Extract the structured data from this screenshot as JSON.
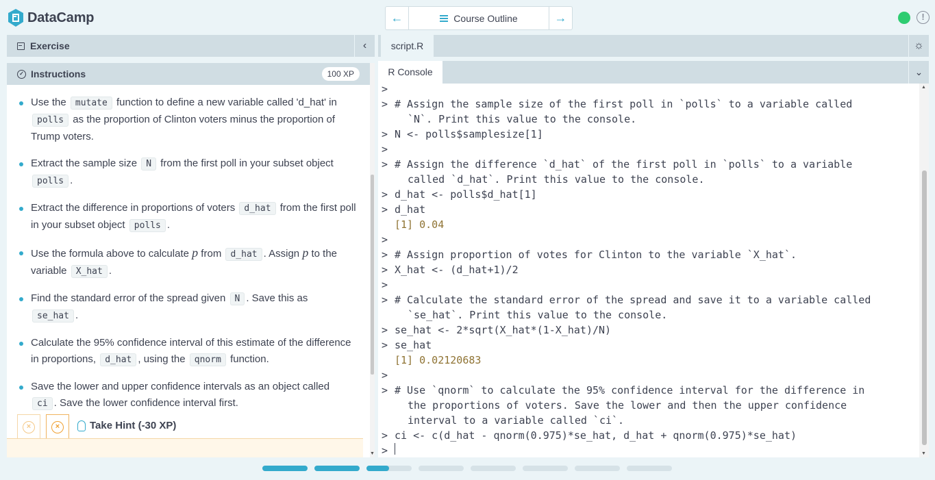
{
  "brand": {
    "name": "DataCamp",
    "color": "#33aacc"
  },
  "nav": {
    "outline_label": "Course Outline",
    "prev_icon": "arrow-left-icon",
    "next_icon": "arrow-right-icon",
    "status_color": "#2ecc71",
    "alert_symbol": "!"
  },
  "left": {
    "exercise_label": "Exercise",
    "collapse_symbol": "‹",
    "instructions_label": "Instructions",
    "xp": "100 XP",
    "items": [
      {
        "parts": [
          {
            "t": "Use the "
          },
          {
            "c": "mutate"
          },
          {
            "t": " function to define a new variable called 'd_hat' in "
          },
          {
            "c": "polls"
          },
          {
            "t": " as the proportion of Clinton voters minus the proportion of Trump voters."
          }
        ]
      },
      {
        "parts": [
          {
            "t": "Extract the sample size "
          },
          {
            "c": "N"
          },
          {
            "t": " from the first poll in your subset object "
          },
          {
            "c": "polls"
          },
          {
            "t": "."
          }
        ]
      },
      {
        "parts": [
          {
            "t": "Extract the difference in proportions of voters "
          },
          {
            "c": "d_hat"
          },
          {
            "t": " from the first poll in your subset object "
          },
          {
            "c": "polls"
          },
          {
            "t": "."
          }
        ]
      },
      {
        "parts": [
          {
            "t": "Use the formula above to calculate "
          },
          {
            "m": "p"
          },
          {
            "t": " from "
          },
          {
            "c": "d_hat"
          },
          {
            "t": ". Assign "
          },
          {
            "m": "p"
          },
          {
            "t": " to the variable "
          },
          {
            "c": "X_hat"
          },
          {
            "t": "."
          }
        ]
      },
      {
        "parts": [
          {
            "t": "Find the standard error of the spread given "
          },
          {
            "c": "N"
          },
          {
            "t": ". Save this as "
          },
          {
            "c": "se_hat"
          },
          {
            "t": "."
          }
        ]
      },
      {
        "parts": [
          {
            "t": "Calculate the 95% confidence interval of this estimate of the difference in proportions, "
          },
          {
            "c": "d_hat"
          },
          {
            "t": ", using the "
          },
          {
            "c": "qnorm"
          },
          {
            "t": " function."
          }
        ]
      },
      {
        "parts": [
          {
            "t": "Save the lower and upper confidence intervals as an object called "
          },
          {
            "c": "ci"
          },
          {
            "t": ". Save the lower confidence interval first."
          }
        ]
      }
    ],
    "hint_label": "Take Hint (-30 XP)"
  },
  "right": {
    "script_tab": "script.R",
    "console_tab": "R Console",
    "lines": [
      {
        "p": ">",
        "t": ""
      },
      {
        "p": ">",
        "t": "# Assign the sample size of the first poll in `polls` to a variable called"
      },
      {
        "p": "",
        "t": "`N`. Print this value to the console.",
        "cont": true
      },
      {
        "p": ">",
        "t": "N <- polls$samplesize[1]"
      },
      {
        "p": ">",
        "t": ""
      },
      {
        "p": ">",
        "t": "# Assign the difference `d_hat` of the first poll in `polls` to a variable"
      },
      {
        "p": "",
        "t": "called `d_hat`. Print this value to the console.",
        "cont": true
      },
      {
        "p": ">",
        "t": "d_hat <- polls$d_hat[1]"
      },
      {
        "p": ">",
        "t": "d_hat"
      },
      {
        "p": "",
        "t": "[1] 0.04",
        "result": true
      },
      {
        "p": ">",
        "t": ""
      },
      {
        "p": ">",
        "t": "# Assign proportion of votes for Clinton to the variable `X_hat`."
      },
      {
        "p": ">",
        "t": "X_hat <- (d_hat+1)/2"
      },
      {
        "p": ">",
        "t": ""
      },
      {
        "p": ">",
        "t": "# Calculate the standard error of the spread and save it to a variable called"
      },
      {
        "p": "",
        "t": "`se_hat`. Print this value to the console.",
        "cont": true
      },
      {
        "p": ">",
        "t": "se_hat <- 2*sqrt(X_hat*(1-X_hat)/N)"
      },
      {
        "p": ">",
        "t": "se_hat"
      },
      {
        "p": "",
        "t": "[1] 0.02120683",
        "result": true
      },
      {
        "p": ">",
        "t": ""
      },
      {
        "p": ">",
        "t": "# Use `qnorm` to calculate the 95% confidence interval for the difference in"
      },
      {
        "p": "",
        "t": "the proportions of voters. Save the lower and then the upper confidence",
        "cont": true
      },
      {
        "p": "",
        "t": "interval to a variable called `ci`.",
        "cont": true
      },
      {
        "p": ">",
        "t": "ci <- c(d_hat - qnorm(0.975)*se_hat, d_hat + qnorm(0.975)*se_hat)"
      },
      {
        "p": ">",
        "t": "",
        "cursor": true
      }
    ]
  },
  "progress": {
    "segments": [
      1,
      1,
      0.5,
      0,
      0,
      0,
      0,
      0
    ],
    "fill_color": "#33aacc",
    "track_color": "#d6e2e7"
  }
}
